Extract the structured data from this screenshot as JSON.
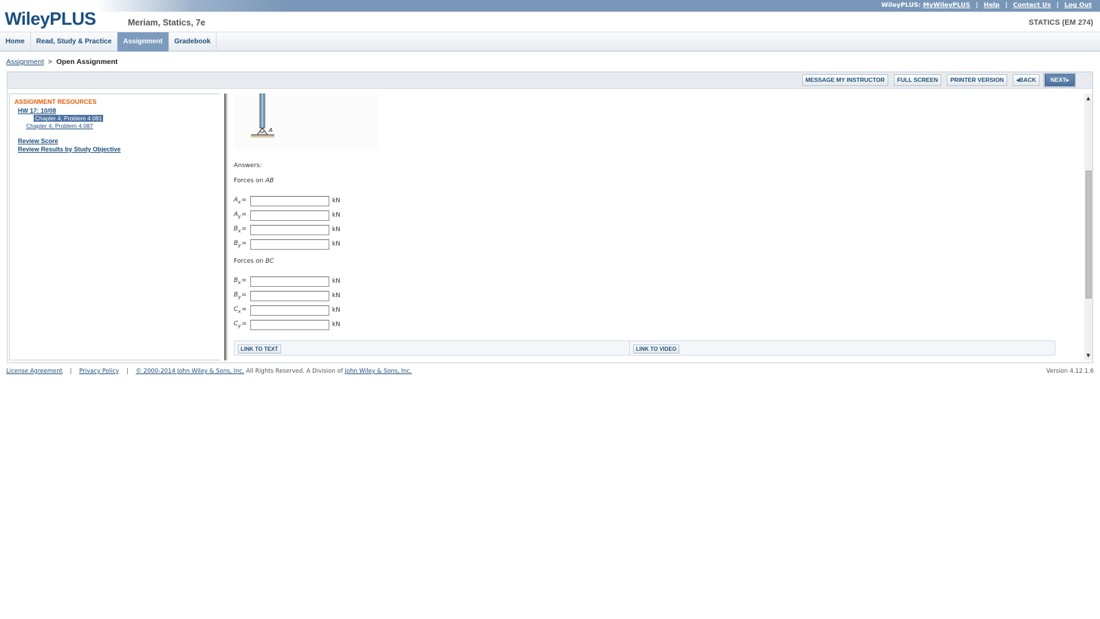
{
  "header": {
    "logo": "WileyPLUS",
    "course_title": "Meriam, Statics, 7e",
    "course_code": "STATICS (EM 274)",
    "top_links": {
      "prefix": "WileyPLUS:",
      "my_wileyplus": "MyWileyPLUS",
      "help": "Help",
      "contact": "Contact Us",
      "logout": "Log Out",
      "separator": "|"
    }
  },
  "nav": {
    "tabs": [
      {
        "label": "Home"
      },
      {
        "label": "Read, Study & Practice"
      },
      {
        "label": "Assignment",
        "active": true
      },
      {
        "label": "Gradebook"
      }
    ]
  },
  "breadcrumb": {
    "link": "Assignment",
    "separator": ">",
    "current": "Open Assignment"
  },
  "toolbar": {
    "message_instructor": "MESSAGE MY INSTRUCTOR",
    "full_screen": "FULL SCREEN",
    "printer_version": "PRINTER VERSION",
    "back": "BACK",
    "next": "NEXT"
  },
  "sidebar": {
    "heading": "ASSIGNMENT RESOURCES",
    "hw_link": "HW 17: 10/08",
    "problems": [
      {
        "label": "Chapter 4, Problem 4.081",
        "selected": true
      },
      {
        "label": "Chapter 4, Problem 4.087",
        "selected": false
      }
    ],
    "review_score": "Review Score",
    "review_results": "Review Results by Study Objective"
  },
  "content": {
    "figure_label": "A",
    "answers_label": "Answers:",
    "group_ab": {
      "title_prefix": "Forces on ",
      "title_member": "AB",
      "rows": [
        {
          "var": "A",
          "sub": "x",
          "value": "",
          "unit": "kN"
        },
        {
          "var": "A",
          "sub": "y",
          "value": "",
          "unit": "kN"
        },
        {
          "var": "B",
          "sub": "x",
          "value": "",
          "unit": "kN"
        },
        {
          "var": "B",
          "sub": "y",
          "value": "",
          "unit": "kN"
        }
      ]
    },
    "group_bc": {
      "title_prefix": "Forces on ",
      "title_member": "BC",
      "rows": [
        {
          "var": "B",
          "sub": "x",
          "value": "",
          "unit": "kN"
        },
        {
          "var": "B",
          "sub": "y",
          "value": "",
          "unit": "kN"
        },
        {
          "var": "C",
          "sub": "x",
          "value": "",
          "unit": "kN"
        },
        {
          "var": "C",
          "sub": "y",
          "value": "",
          "unit": "kN"
        }
      ]
    },
    "eq_sign": "=",
    "link_to_text": "LINK TO TEXT",
    "link_to_video": "LINK TO VIDEO"
  },
  "footer": {
    "license": "License Agreement",
    "privacy": "Privacy Policy",
    "copyright_link": "© 2000-2014 John Wiley & Sons, Inc.",
    "rights_text": " All Rights Reserved. A Division of ",
    "wiley_link": "John Wiley & Sons, Inc.",
    "separator": "|",
    "version": "Version 4.12.1.6"
  },
  "icons": {
    "back_arrow": "◂",
    "next_arrow": "▸",
    "scroll_up": "▲",
    "scroll_down": "▼"
  },
  "colors": {
    "brand_blue": "#1b4f7f",
    "nav_active": "#7c9bbd",
    "resources_heading": "#e0600b",
    "selected_item": "#4c72a2"
  }
}
